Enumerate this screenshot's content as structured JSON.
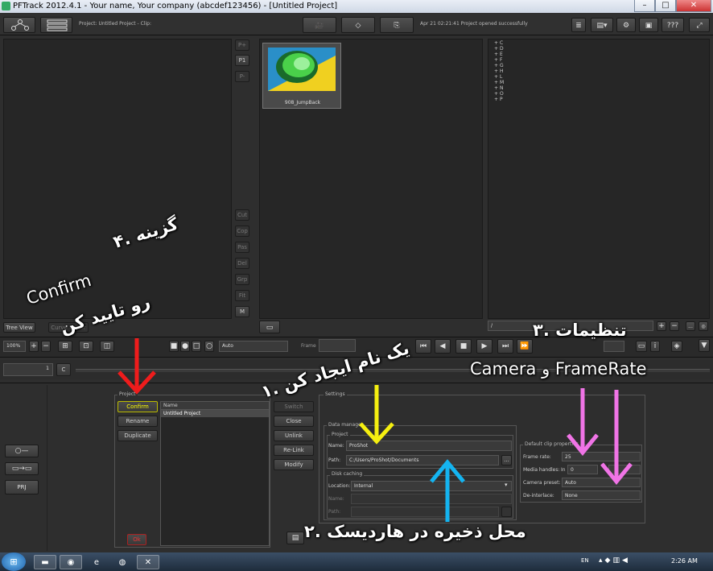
{
  "window": {
    "title": "PFTrack 2012.4.1 - Your name, Your company (abcdef123456) - [Untitled Project]",
    "minimize": "–",
    "maximize": "□",
    "close": "✕"
  },
  "topbar": {
    "project_info": "Project: Untitled Project - Clip:",
    "status": "Apr 21 02:21:41 Project opened successfully",
    "help_label": "???"
  },
  "left_toolbar": {
    "p_plus": "P+",
    "p1": "P1",
    "p_minus": "P-",
    "tools": [
      "Cut",
      "Cop",
      "Pas",
      "Del",
      "Grp",
      "Fit",
      "M"
    ]
  },
  "clip": {
    "name": "908_JumpBack"
  },
  "right_list": {
    "items": [
      "C",
      "D",
      "E",
      "F",
      "G",
      "H",
      "L",
      "M",
      "N",
      "O",
      "P"
    ]
  },
  "left_tabs": {
    "tree_view": "Tree View",
    "curve_editor": "Curve Editor"
  },
  "timeline": {
    "zoom": "100%",
    "frame_label": "Frame",
    "auto_select": "Auto",
    "frame_field": "1",
    "c_button": "C",
    "slash_field": "/",
    "frame_count": "1"
  },
  "project": {
    "group_label": "Project",
    "confirm": "Confirm",
    "rename": "Rename",
    "duplicate": "Duplicate",
    "ok": "Ok",
    "list_header": "Name",
    "list_items": [
      "Untitled Project"
    ],
    "switch": "Switch",
    "close": "Close",
    "unlink": "Unlink",
    "relink": "Re-Link",
    "modify": "Modify"
  },
  "settings": {
    "group_label": "Settings",
    "data_manager_label": "Data manager",
    "project_label": "Project",
    "name_label": "Name:",
    "name_value": "ProShot",
    "path_label": "Path:",
    "path_value": "C:/Users/ProShot/Documents",
    "browse": "...",
    "disk_caching_label": "Disk caching",
    "location_label": "Location:",
    "location_value": "Internal",
    "dc_name_label": "Name:",
    "dc_path_label": "Path:",
    "clip_props_label": "Default clip properties",
    "frame_rate_label": "Frame rate:",
    "frame_rate_value": "25",
    "media_handles_label": "Media handles:",
    "media_in_label": "In",
    "media_in_value": "0",
    "camera_preset_label": "Camera preset:",
    "camera_preset_value": "Auto",
    "deinterlace_label": "De-interlace:",
    "deinterlace_value": "None"
  },
  "side_icons": {
    "prj": "PRJ"
  },
  "overlays": {
    "step4_line1": "۴. گزینه",
    "step4_confirm": "Confirm",
    "step4_line2": "رو تایید کن",
    "step1_line1": "۱. یک نام ایجاد کن",
    "step3_line1": "۳. تنظیمات",
    "step3_line2": "Camera و FrameRate",
    "step2_line1": "۲. محل ذخیره در هاردیسک",
    "colors": {
      "red": "#ee1c1c",
      "yellow": "#f5ef10",
      "pink": "#f074e6",
      "cyan": "#14b4f0"
    }
  },
  "taskbar": {
    "lang": "EN",
    "time": "2:26 AM"
  }
}
